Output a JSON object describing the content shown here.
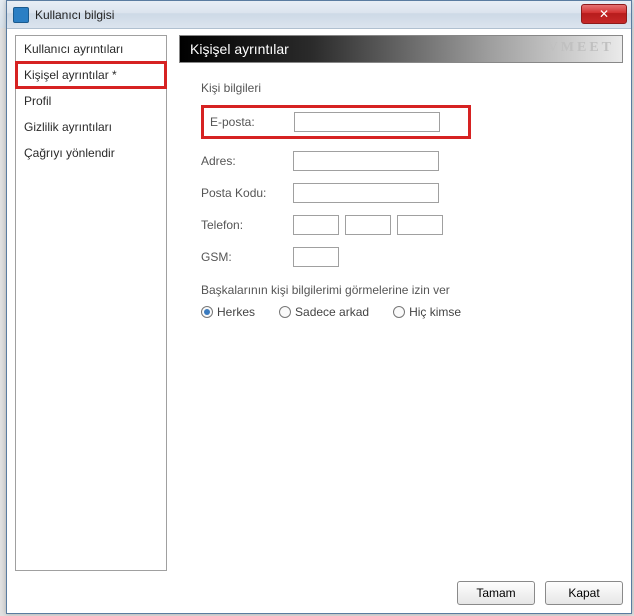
{
  "window": {
    "title": "Kullanıcı bilgisi",
    "close": "✕"
  },
  "sidenav": {
    "items": [
      {
        "label": "Kullanıcı ayrıntıları"
      },
      {
        "label": "Kişişel ayrıntılar *"
      },
      {
        "label": "Profil"
      },
      {
        "label": "Gizlilik ayrıntıları"
      },
      {
        "label": "Çağrıyı yönlendir"
      }
    ]
  },
  "header": {
    "title": "Kişişel ayrıntılar",
    "brand": "VMEET"
  },
  "section": {
    "contact_info": "Kişi bilgileri",
    "email_label": "E-posta:",
    "email_value": "",
    "address_label": "Adres:",
    "address_value": "",
    "postal_label": "Posta Kodu:",
    "postal_value": "",
    "phone_label": "Telefon:",
    "phone_a": "",
    "phone_b": "",
    "phone_c": "",
    "gsm_label": "GSM:",
    "gsm_value": ""
  },
  "permissions": {
    "title": "Başkalarının kişi bilgilerimi görmelerine izin ver",
    "options": [
      {
        "label": "Herkes",
        "selected": true
      },
      {
        "label": "Sadece arkad",
        "selected": false
      },
      {
        "label": "Hiç kimse",
        "selected": false
      }
    ]
  },
  "footer": {
    "ok": "Tamam",
    "close": "Kapat"
  }
}
